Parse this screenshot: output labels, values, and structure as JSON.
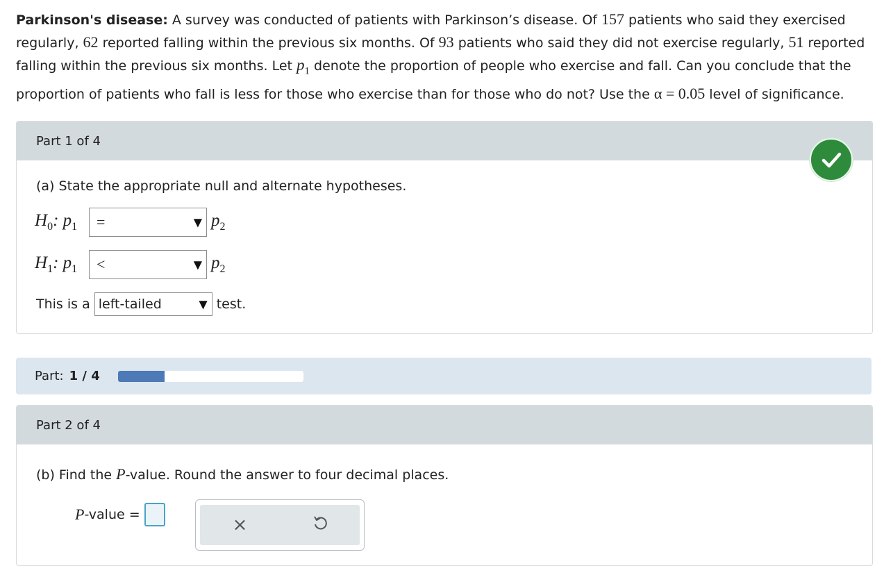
{
  "problem": {
    "title": "Parkinson's disease:",
    "segments": [
      " A survey was conducted of patients with Parkinson’s disease. Of ",
      "157",
      " patients who said they exercised regularly, ",
      "62",
      " reported falling within the previous six months. Of ",
      "93",
      " patients who said they did not exercise regularly, ",
      "51",
      " reported falling within the previous six months. Let ",
      " denote the proportion of people who exercise and fall. Can you conclude that the proportion of patients who fall is less for those who exercise than for those who do not? Use the ",
      "α = 0.05",
      " level of significance."
    ],
    "p_symbol": "p",
    "p_sub": "1"
  },
  "part1": {
    "header": "Part 1 of 4",
    "status": "check-circle-icon",
    "question": "(a) State the appropriate null and alternate hypotheses.",
    "h0": {
      "label": "H",
      "sub": "0",
      "p_left": ": p",
      "p_left_sub": "1",
      "selected": "=",
      "p_right": "p",
      "p_right_sub": "2"
    },
    "h1": {
      "label": "H",
      "sub": "1",
      "p_left": ": p",
      "p_left_sub": "1",
      "selected": "<",
      "p_right": "p",
      "p_right_sub": "2"
    },
    "test_prefix": "This is a",
    "test_selected": "left-tailed",
    "test_suffix": "test."
  },
  "progress": {
    "label": "Part:",
    "value": "1 / 4",
    "fraction": 0.25,
    "fill_color": "#4d7ab7"
  },
  "part2": {
    "header": "Part 2 of 4",
    "question_prefix": "(b) Find the ",
    "question_P": "P",
    "question_suffix": "-value. Round the answer to four decimal places.",
    "answer_P": "P",
    "answer_label": "-value =",
    "answer_value": "",
    "clear_icon": "close-icon",
    "undo_icon": "undo-icon"
  },
  "arrow_glyph": "▼",
  "clear_glyph": "×"
}
